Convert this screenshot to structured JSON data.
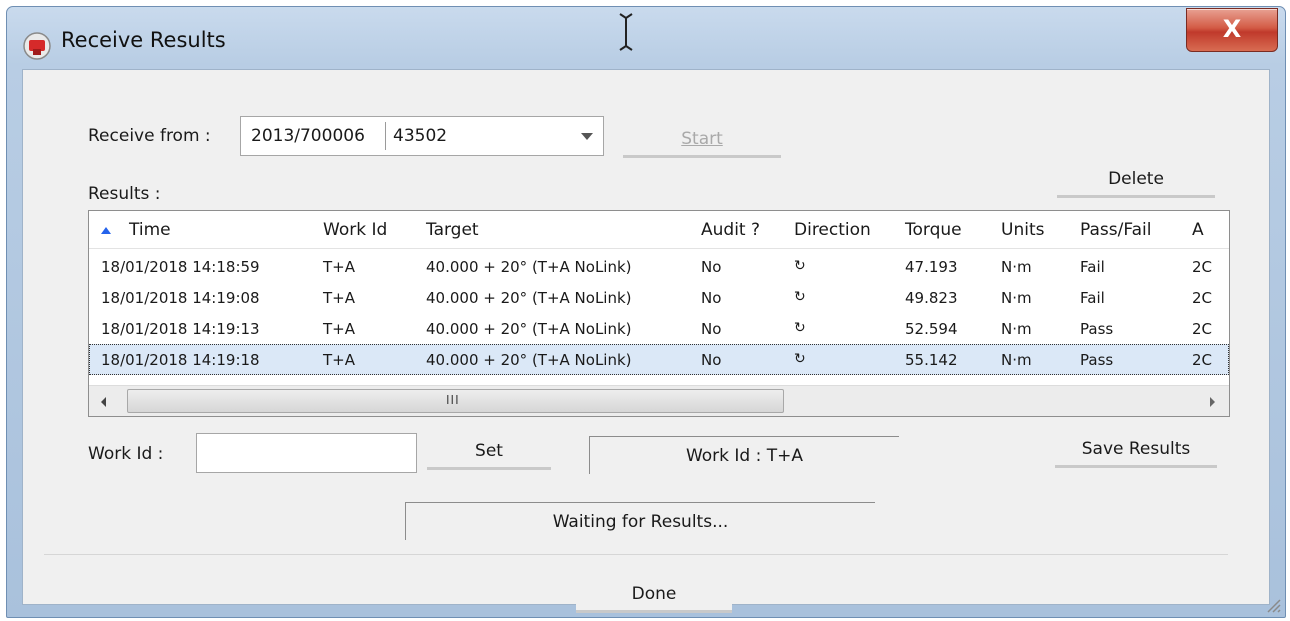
{
  "window": {
    "title": "Receive Results",
    "close_label": "X"
  },
  "receive": {
    "label": "Receive from :",
    "selected_part1": "2013/700006",
    "selected_part2": "43502",
    "start_label": "Start"
  },
  "results": {
    "label": "Results :",
    "delete_label": "Delete",
    "columns": [
      "Time",
      "Work Id",
      "Target",
      "Audit ?",
      "Direction",
      "Torque",
      "Units",
      "Pass/Fail",
      "A"
    ],
    "rows": [
      {
        "time": "18/01/2018 14:18:59",
        "work_id": "T+A",
        "target": "40.000 + 20° (T+A NoLink)",
        "audit": "No",
        "direction": "↻",
        "torque": "47.193",
        "units": "N·m",
        "pass_fail": "Fail",
        "extra": "2C"
      },
      {
        "time": "18/01/2018 14:19:08",
        "work_id": "T+A",
        "target": "40.000 + 20° (T+A NoLink)",
        "audit": "No",
        "direction": "↻",
        "torque": "49.823",
        "units": "N·m",
        "pass_fail": "Fail",
        "extra": "2C"
      },
      {
        "time": "18/01/2018 14:19:13",
        "work_id": "T+A",
        "target": "40.000 + 20° (T+A NoLink)",
        "audit": "No",
        "direction": "↻",
        "torque": "52.594",
        "units": "N·m",
        "pass_fail": "Pass",
        "extra": "2C"
      },
      {
        "time": "18/01/2018 14:19:18",
        "work_id": "T+A",
        "target": "40.000 + 20° (T+A NoLink)",
        "audit": "No",
        "direction": "↻",
        "torque": "55.142",
        "units": "N·m",
        "pass_fail": "Pass",
        "extra": "2C"
      }
    ],
    "scroll_grip": "III"
  },
  "work": {
    "label": "Work Id :",
    "input_value": "",
    "set_label": "Set",
    "current": "Work Id : T+A",
    "save_label": "Save Results"
  },
  "status": {
    "text": "Waiting for Results..."
  },
  "footer": {
    "done_label": "Done"
  },
  "colors": {
    "accent": "#2563eb",
    "close": "#c0392b"
  }
}
